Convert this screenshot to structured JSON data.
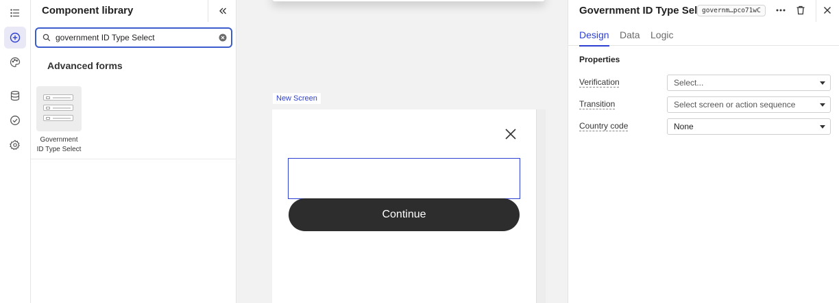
{
  "library": {
    "title": "Component library",
    "search": {
      "value": "government ID Type Select",
      "placeholder": "Search components"
    },
    "section_title": "Advanced forms",
    "components": [
      {
        "label": "Government ID Type Select"
      }
    ]
  },
  "canvas": {
    "screen_label": "New Screen",
    "continue_label": "Continue"
  },
  "properties": {
    "title": "Government ID Type Sel...",
    "component_id": "governm…pco71wC",
    "tabs": [
      {
        "label": "Design",
        "active": true
      },
      {
        "label": "Data",
        "active": false
      },
      {
        "label": "Logic",
        "active": false
      }
    ],
    "section_title": "Properties",
    "fields": [
      {
        "label": "Verification",
        "value": "Select..."
      },
      {
        "label": "Transition",
        "value": "Select screen or action sequence"
      },
      {
        "label": "Country code",
        "value": "None"
      }
    ]
  },
  "colors": {
    "accent": "#2c3fd1",
    "search_border": "#3b5ccc",
    "button_bg": "#2d2d2d",
    "canvas_bg": "#f2f2f2"
  },
  "icons": {
    "rail": [
      "list-icon",
      "add-circle-icon",
      "palette-icon",
      "database-icon",
      "check-circle-icon",
      "gear-icon"
    ],
    "header": [
      "collapse-panel-icon",
      "more-icon",
      "trash-icon",
      "close-icon"
    ]
  }
}
